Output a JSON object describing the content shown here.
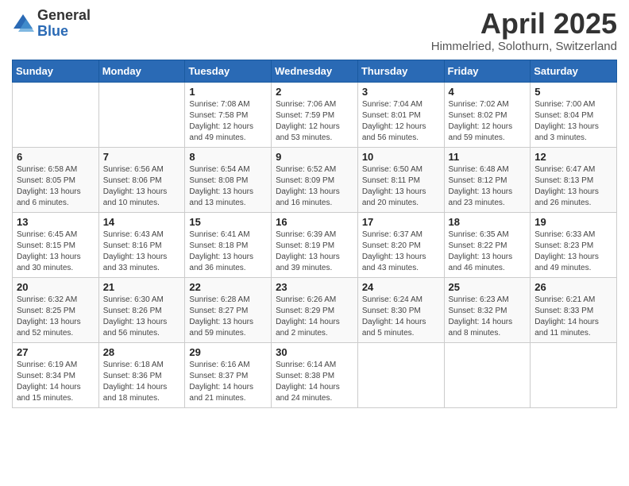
{
  "logo": {
    "general": "General",
    "blue": "Blue"
  },
  "title": "April 2025",
  "location": "Himmelried, Solothurn, Switzerland",
  "weekdays": [
    "Sunday",
    "Monday",
    "Tuesday",
    "Wednesday",
    "Thursday",
    "Friday",
    "Saturday"
  ],
  "weeks": [
    [
      {
        "day": "",
        "info": ""
      },
      {
        "day": "",
        "info": ""
      },
      {
        "day": "1",
        "info": "Sunrise: 7:08 AM\nSunset: 7:58 PM\nDaylight: 12 hours and 49 minutes."
      },
      {
        "day": "2",
        "info": "Sunrise: 7:06 AM\nSunset: 7:59 PM\nDaylight: 12 hours and 53 minutes."
      },
      {
        "day": "3",
        "info": "Sunrise: 7:04 AM\nSunset: 8:01 PM\nDaylight: 12 hours and 56 minutes."
      },
      {
        "day": "4",
        "info": "Sunrise: 7:02 AM\nSunset: 8:02 PM\nDaylight: 12 hours and 59 minutes."
      },
      {
        "day": "5",
        "info": "Sunrise: 7:00 AM\nSunset: 8:04 PM\nDaylight: 13 hours and 3 minutes."
      }
    ],
    [
      {
        "day": "6",
        "info": "Sunrise: 6:58 AM\nSunset: 8:05 PM\nDaylight: 13 hours and 6 minutes."
      },
      {
        "day": "7",
        "info": "Sunrise: 6:56 AM\nSunset: 8:06 PM\nDaylight: 13 hours and 10 minutes."
      },
      {
        "day": "8",
        "info": "Sunrise: 6:54 AM\nSunset: 8:08 PM\nDaylight: 13 hours and 13 minutes."
      },
      {
        "day": "9",
        "info": "Sunrise: 6:52 AM\nSunset: 8:09 PM\nDaylight: 13 hours and 16 minutes."
      },
      {
        "day": "10",
        "info": "Sunrise: 6:50 AM\nSunset: 8:11 PM\nDaylight: 13 hours and 20 minutes."
      },
      {
        "day": "11",
        "info": "Sunrise: 6:48 AM\nSunset: 8:12 PM\nDaylight: 13 hours and 23 minutes."
      },
      {
        "day": "12",
        "info": "Sunrise: 6:47 AM\nSunset: 8:13 PM\nDaylight: 13 hours and 26 minutes."
      }
    ],
    [
      {
        "day": "13",
        "info": "Sunrise: 6:45 AM\nSunset: 8:15 PM\nDaylight: 13 hours and 30 minutes."
      },
      {
        "day": "14",
        "info": "Sunrise: 6:43 AM\nSunset: 8:16 PM\nDaylight: 13 hours and 33 minutes."
      },
      {
        "day": "15",
        "info": "Sunrise: 6:41 AM\nSunset: 8:18 PM\nDaylight: 13 hours and 36 minutes."
      },
      {
        "day": "16",
        "info": "Sunrise: 6:39 AM\nSunset: 8:19 PM\nDaylight: 13 hours and 39 minutes."
      },
      {
        "day": "17",
        "info": "Sunrise: 6:37 AM\nSunset: 8:20 PM\nDaylight: 13 hours and 43 minutes."
      },
      {
        "day": "18",
        "info": "Sunrise: 6:35 AM\nSunset: 8:22 PM\nDaylight: 13 hours and 46 minutes."
      },
      {
        "day": "19",
        "info": "Sunrise: 6:33 AM\nSunset: 8:23 PM\nDaylight: 13 hours and 49 minutes."
      }
    ],
    [
      {
        "day": "20",
        "info": "Sunrise: 6:32 AM\nSunset: 8:25 PM\nDaylight: 13 hours and 52 minutes."
      },
      {
        "day": "21",
        "info": "Sunrise: 6:30 AM\nSunset: 8:26 PM\nDaylight: 13 hours and 56 minutes."
      },
      {
        "day": "22",
        "info": "Sunrise: 6:28 AM\nSunset: 8:27 PM\nDaylight: 13 hours and 59 minutes."
      },
      {
        "day": "23",
        "info": "Sunrise: 6:26 AM\nSunset: 8:29 PM\nDaylight: 14 hours and 2 minutes."
      },
      {
        "day": "24",
        "info": "Sunrise: 6:24 AM\nSunset: 8:30 PM\nDaylight: 14 hours and 5 minutes."
      },
      {
        "day": "25",
        "info": "Sunrise: 6:23 AM\nSunset: 8:32 PM\nDaylight: 14 hours and 8 minutes."
      },
      {
        "day": "26",
        "info": "Sunrise: 6:21 AM\nSunset: 8:33 PM\nDaylight: 14 hours and 11 minutes."
      }
    ],
    [
      {
        "day": "27",
        "info": "Sunrise: 6:19 AM\nSunset: 8:34 PM\nDaylight: 14 hours and 15 minutes."
      },
      {
        "day": "28",
        "info": "Sunrise: 6:18 AM\nSunset: 8:36 PM\nDaylight: 14 hours and 18 minutes."
      },
      {
        "day": "29",
        "info": "Sunrise: 6:16 AM\nSunset: 8:37 PM\nDaylight: 14 hours and 21 minutes."
      },
      {
        "day": "30",
        "info": "Sunrise: 6:14 AM\nSunset: 8:38 PM\nDaylight: 14 hours and 24 minutes."
      },
      {
        "day": "",
        "info": ""
      },
      {
        "day": "",
        "info": ""
      },
      {
        "day": "",
        "info": ""
      }
    ]
  ]
}
